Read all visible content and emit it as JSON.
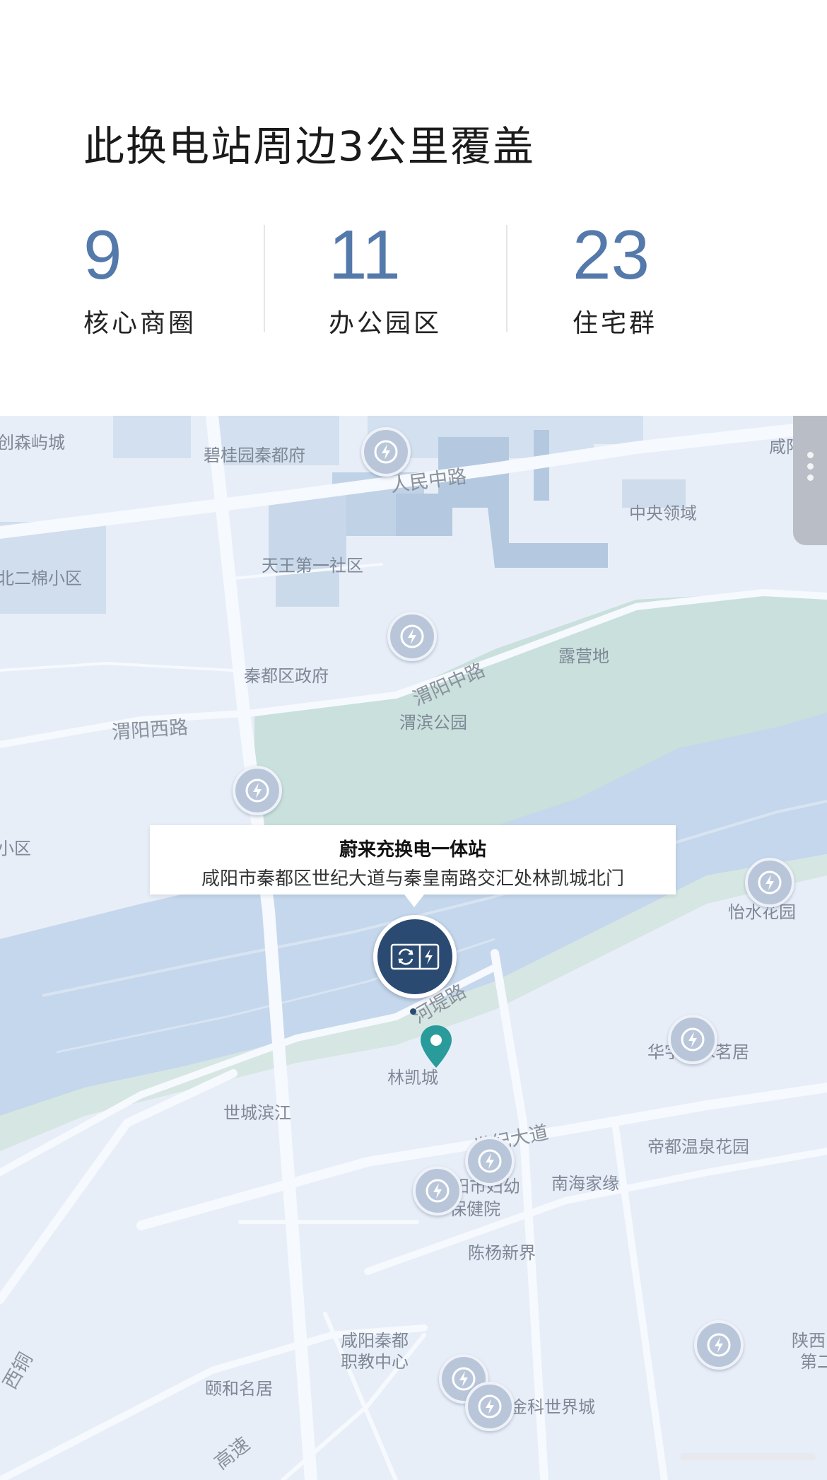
{
  "header": {
    "title": "此换电站周边3公里覆盖",
    "stats": [
      {
        "value": "9",
        "label": "核心商圈"
      },
      {
        "value": "11",
        "label": "办公园区"
      },
      {
        "value": "23",
        "label": "住宅群"
      }
    ]
  },
  "map": {
    "places": [
      "创森屿城",
      "碧桂园秦都府",
      "咸阳市市",
      "中央领域",
      "北二棉小区",
      "天王第一社区",
      "露营地",
      "秦都区政府",
      "渭滨公园",
      "小区",
      "怡水花园",
      "林凯城",
      "华宇碧水茗居",
      "世城滨江",
      "帝都温泉花园",
      "南海家缘",
      "阳市妇幼",
      "保健院",
      "陈杨新界",
      "咸阳秦都",
      "职教中心",
      "颐和名居",
      "金科世界城",
      "陕西",
      "第二"
    ],
    "roads": [
      "人民中路",
      "渭阳中路",
      "渭阳西路",
      "河堤路",
      "世纪大道",
      "高速",
      "西铜"
    ],
    "popup": {
      "name": "蔚来充换电一体站",
      "address": "咸阳市秦都区世纪大道与秦皇南路交汇处林凯城北门"
    }
  },
  "icons": {
    "station": "charging-station-icon",
    "swap": "battery-swap-icon",
    "pin": "location-pin-icon",
    "more": "more-vertical-icon"
  },
  "colors": {
    "accent": "#5479ab",
    "water": "#c5d7ec",
    "park": "#c9e0dc",
    "land": "#e8eef8",
    "pin": "#2b4a72",
    "poi": "#2a9b9b"
  }
}
